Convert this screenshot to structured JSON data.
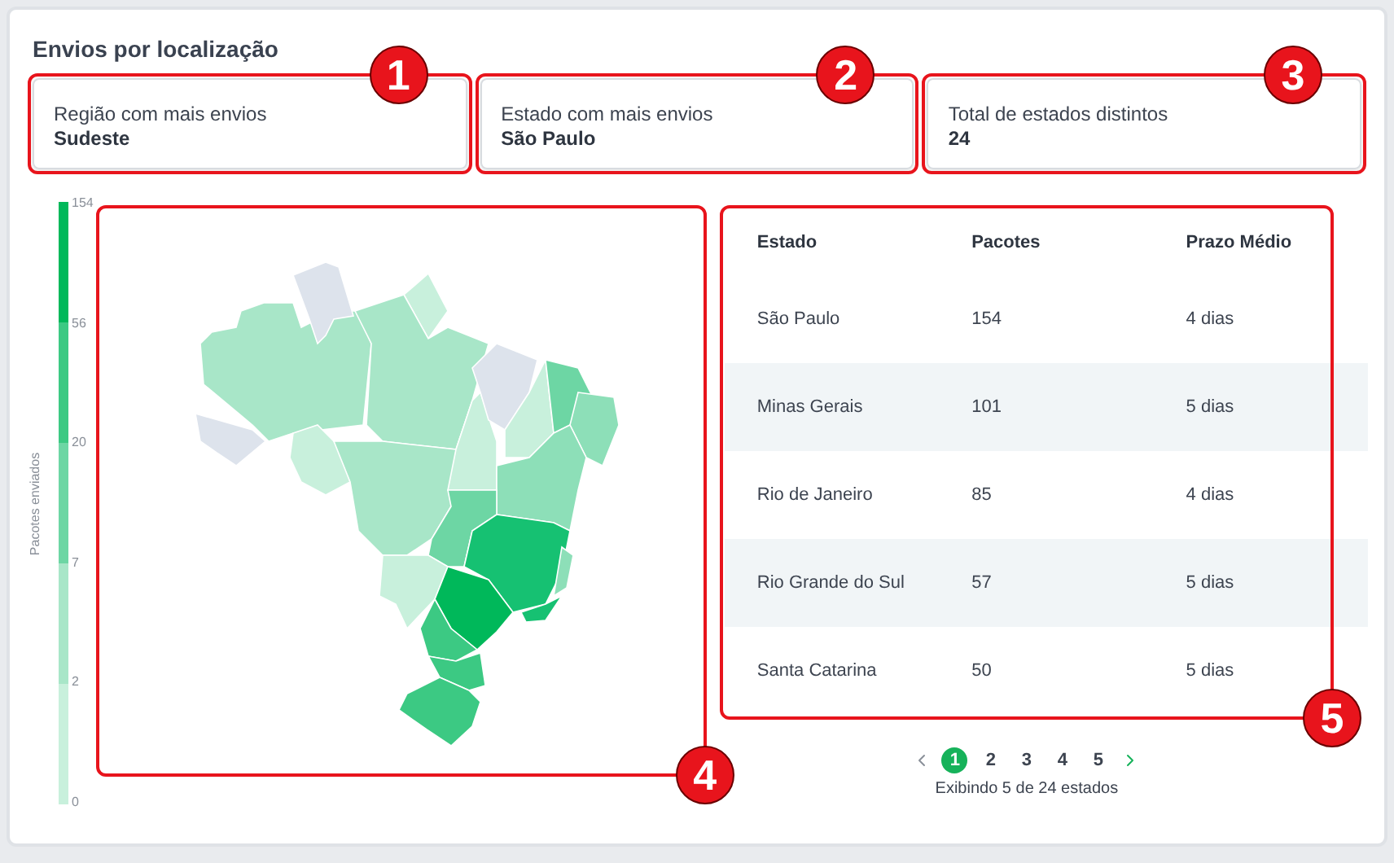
{
  "title": "Envios por localização",
  "stats": [
    {
      "label": "Região com mais envios",
      "value": "Sudeste",
      "marker": "1"
    },
    {
      "label": "Estado com mais envios",
      "value": "São Paulo",
      "marker": "2"
    },
    {
      "label": "Total de estados distintos",
      "value": "24",
      "marker": "3"
    }
  ],
  "legend": {
    "title": "Pacotes enviados",
    "ticks": [
      "154",
      "56",
      "20",
      "7",
      "2",
      "0"
    ],
    "bands": [
      {
        "color": "#00b85a"
      },
      {
        "color": "#3cc983"
      },
      {
        "color": "#6dd6a4"
      },
      {
        "color": "#a8e6c8"
      },
      {
        "color": "#c8f0dc"
      }
    ]
  },
  "map": {
    "marker": "4"
  },
  "table": {
    "marker": "5",
    "columns": [
      "Estado",
      "Pacotes",
      "Prazo Médio"
    ],
    "rows": [
      [
        "São Paulo",
        "154",
        "4 dias"
      ],
      [
        "Minas Gerais",
        "101",
        "5 dias"
      ],
      [
        "Rio de Janeiro",
        "85",
        "4 dias"
      ],
      [
        "Rio Grande do Sul",
        "57",
        "5 dias"
      ],
      [
        "Santa Catarina",
        "50",
        "5 dias"
      ]
    ]
  },
  "pagination": {
    "prev_disabled": true,
    "next_disabled": false,
    "pages": [
      {
        "label": "1",
        "selected": true
      },
      {
        "label": "2",
        "selected": false
      },
      {
        "label": "3",
        "selected": false
      },
      {
        "label": "4",
        "selected": false
      },
      {
        "label": "5",
        "selected": false
      }
    ],
    "summary": "Exibindo 5 de 24 estados"
  }
}
